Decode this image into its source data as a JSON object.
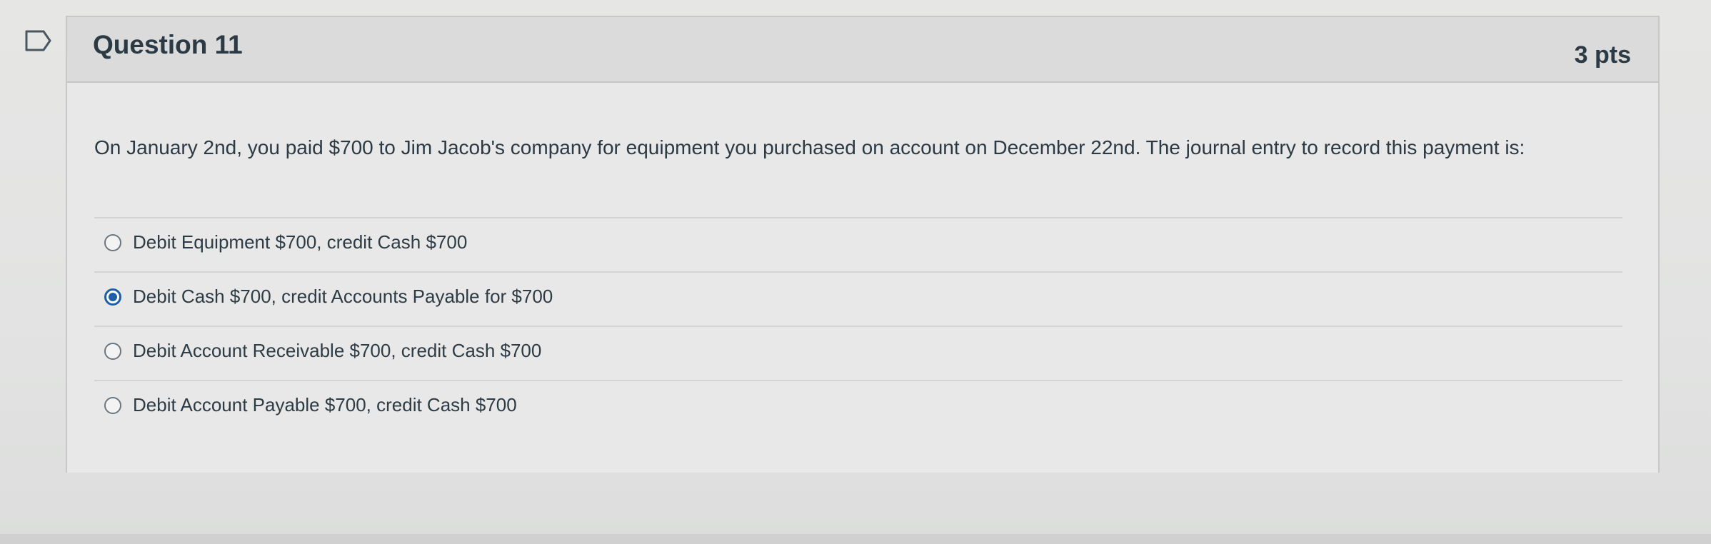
{
  "question": {
    "title": "Question 11",
    "points": "3 pts",
    "text": "On January 2nd, you paid $700 to Jim Jacob's company for equipment you purchased on account on December 22nd. The journal entry to record this payment is:",
    "flag_icon": "bookmark-flag-icon",
    "answers": [
      {
        "label": "Debit Equipment $700, credit Cash $700",
        "selected": false
      },
      {
        "label": "Debit Cash $700, credit Accounts Payable for $700",
        "selected": true
      },
      {
        "label": "Debit Account Receivable $700, credit Cash $700",
        "selected": false
      },
      {
        "label": "Debit Account Payable $700, credit Cash $700",
        "selected": false
      }
    ]
  },
  "colors": {
    "accent": "#1f5fa8",
    "text": "#2b3a44",
    "header_bg": "#dadbda"
  }
}
